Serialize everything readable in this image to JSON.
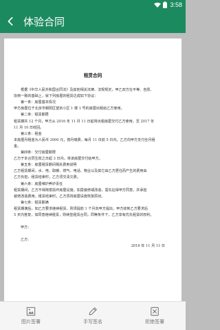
{
  "status_bar": {
    "time": "3:58",
    "icons": [
      "wifi-icon",
      "battery-icon"
    ]
  },
  "app_bar": {
    "title": "体验合同",
    "back_icon": "back-arrow-icon",
    "color": "#1b8a5e"
  },
  "document": {
    "title": "租赁合同",
    "lines": [
      {
        "text": "根据《中华人民共和国合同法》及其他相关法律、法规规定，甲乙双方在平等、自愿、",
        "style": "indent"
      },
      {
        "text": "协商一致的基础上，就下列房屋的租赁达成如下协议：",
        "style": "plain"
      },
      {
        "text": "第一条：房屋基本情况",
        "style": "indent"
      },
      {
        "text": "甲方房屋位于北京市朝阳区望京小区 1 楼 1 号的房屋出租给乙方使用。",
        "style": "plain"
      },
      {
        "text": "第二条：租赁期限",
        "style": "indent"
      },
      {
        "text": "租赁期共 12 个月，甲方从 2016 年 11 月 11 日起将出租房屋交付乙方使用，至 2017 年",
        "style": "plain"
      },
      {
        "text": "11 月 10 日收回。",
        "style": "plain"
      },
      {
        "text": "第三条：租金",
        "style": "indent"
      },
      {
        "text": "本房屋月租金为人民币 3000 元，按月缴费，每月 11 日前 5 日内，乙方向甲方支付全月租",
        "style": "plain"
      },
      {
        "text": "金。",
        "style": "plain"
      },
      {
        "text": "第四条：交付房屋期限",
        "style": "indent"
      },
      {
        "text": "乙方于本合同生效之日起 3 日内，将该房屋交付给甲方。",
        "style": "plain"
      },
      {
        "text": "第五条：房屋租赁期间相关费用说明",
        "style": "indent"
      },
      {
        "text": "乙方租赁期间，水、电、取暖、燃气、电话、物业以及其它由乙方居住而产生的费用由",
        "style": "plain"
      },
      {
        "text": "乙方负担，租赁结束时，乙方须交清欠费。",
        "style": "plain"
      },
      {
        "text": "第六条：房屋维护养护责任",
        "style": "indent"
      },
      {
        "text": "租赁期间，乙方不得随意损坏房屋设施，如需装修或改造，需先征得甲方同意，并承担",
        "style": "plain"
      },
      {
        "text": "装修改造费用。租赁结束时，乙方须将房屋设施恢复原状。",
        "style": "plain"
      },
      {
        "text": "第七条：租赁期满",
        "style": "indent"
      },
      {
        "text": "租赁期满后，如乙方要求继续租赁，则须提前 1 个月向甲方提出，甲方收到乙方要求后",
        "style": "plain"
      },
      {
        "text": "5 天内答复，如同意继续租赁，则续签租赁合同，同等条件下，乙方享有优先租赁的权利。",
        "style": "plain"
      },
      {
        "text": "",
        "style": "plain"
      },
      {
        "text": "甲方：",
        "style": "indent"
      },
      {
        "text": "",
        "style": "plain"
      },
      {
        "text": "乙方：",
        "style": "indent"
      },
      {
        "text": "2016 年 11 月 11 日",
        "style": "right"
      }
    ]
  },
  "bottom_bar": {
    "actions": [
      {
        "label": "图片签署",
        "icon": "image-sign-icon"
      },
      {
        "label": "手写签名",
        "icon": "pen-icon"
      },
      {
        "label": "拒绝签署",
        "icon": "reject-icon"
      }
    ]
  }
}
